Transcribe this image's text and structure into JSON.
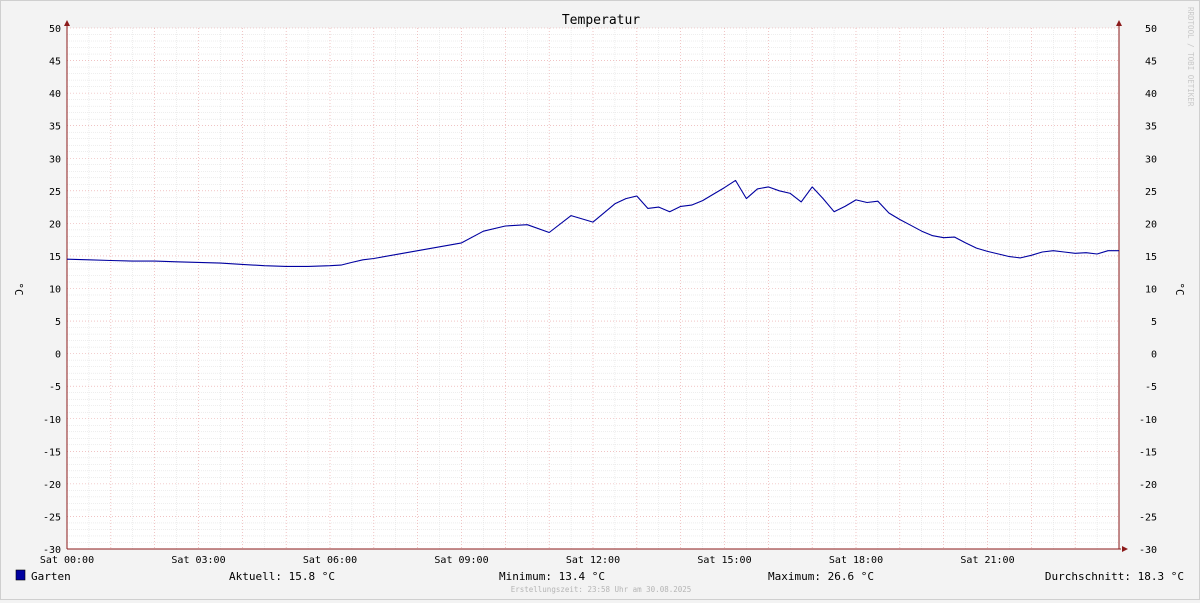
{
  "chart_data": {
    "type": "line",
    "title": "Temperatur",
    "ylabel": "°C",
    "ylim": [
      -30,
      50
    ],
    "yticks": [
      50,
      45,
      40,
      35,
      30,
      25,
      20,
      15,
      10,
      5,
      0,
      -5,
      -10,
      -15,
      -20,
      -25,
      -30
    ],
    "xlim": [
      0,
      24
    ],
    "xtick_values": [
      0,
      3,
      6,
      9,
      12,
      15,
      18,
      21
    ],
    "xtick_labels": [
      "Sat 00:00",
      "Sat 03:00",
      "Sat 06:00",
      "Sat 09:00",
      "Sat 12:00",
      "Sat 15:00",
      "Sat 18:00",
      "Sat 21:00"
    ],
    "grid": true,
    "series": [
      {
        "name": "Garten",
        "color": "#0000a0",
        "x": [
          0,
          0.5,
          1,
          1.5,
          2,
          2.5,
          3,
          3.5,
          4,
          4.5,
          5,
          5.5,
          6,
          6.25,
          6.5,
          6.75,
          7,
          7.5,
          8,
          8.5,
          9,
          9.5,
          10,
          10.5,
          11,
          11.5,
          12,
          12.5,
          12.75,
          13,
          13.25,
          13.5,
          13.75,
          14,
          14.25,
          14.5,
          14.75,
          15,
          15.25,
          15.5,
          15.75,
          16,
          16.25,
          16.5,
          16.75,
          17,
          17.25,
          17.5,
          17.75,
          18,
          18.25,
          18.5,
          18.75,
          19,
          19.25,
          19.5,
          19.75,
          20,
          20.25,
          20.5,
          20.75,
          21,
          21.25,
          21.5,
          21.75,
          22,
          22.25,
          22.5,
          22.75,
          23,
          23.25,
          23.5,
          23.75,
          24
        ],
        "values": [
          14.5,
          14.4,
          14.3,
          14.2,
          14.2,
          14.1,
          14.0,
          13.9,
          13.7,
          13.5,
          13.4,
          13.4,
          13.5,
          13.6,
          14.0,
          14.4,
          14.6,
          15.2,
          15.8,
          16.4,
          17.0,
          18.8,
          19.6,
          19.8,
          18.6,
          21.2,
          20.2,
          23.0,
          23.8,
          24.2,
          22.3,
          22.5,
          21.8,
          22.6,
          22.8,
          23.5,
          24.5,
          25.5,
          26.6,
          23.8,
          25.3,
          25.6,
          25.0,
          24.6,
          23.3,
          25.6,
          23.8,
          21.8,
          22.6,
          23.6,
          23.2,
          23.4,
          21.6,
          20.6,
          19.7,
          18.8,
          18.1,
          17.8,
          17.9,
          17.0,
          16.2,
          15.7,
          15.3,
          14.9,
          14.7,
          15.1,
          15.6,
          15.8,
          15.6,
          15.4,
          15.5,
          15.3,
          15.8,
          15.8
        ]
      }
    ],
    "legend": {
      "swatch_color": "#0000a0",
      "label": "Garten",
      "aktuell": "Aktuell: 15.8 °C",
      "minimum": "Minimum: 13.4 °C",
      "maximum": "Maximum: 26.6 °C",
      "durchschnitt": "Durchschnitt: 18.3 °C"
    },
    "footer": "Erstellungszeit: 23:58 Uhr am 30.08.2025",
    "watermark": "RRDTOOL / TOBI OETIKER",
    "colors": {
      "background": "#f3f3f3",
      "plot_bg": "#ffffff",
      "major_grid": "#e8a0a0",
      "minor_grid": "#dcdcdc",
      "axis": "#8b1a1a"
    }
  }
}
